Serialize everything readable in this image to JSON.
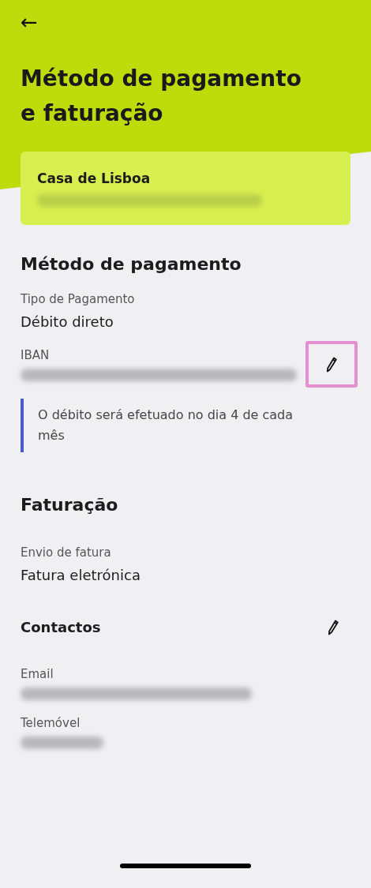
{
  "header": {
    "back": "←",
    "title": "Método de pagamento e faturação"
  },
  "account_card": {
    "name": "Casa de Lisboa",
    "address_blurred": true
  },
  "payment": {
    "heading": "Método de pagamento",
    "fields": [
      {
        "label": "Tipo de Pagamento",
        "value": "Débito direto"
      },
      {
        "label": "IBAN",
        "blurred": true,
        "editable": true,
        "highlighted": true
      }
    ],
    "note": "O débito será efetuado no dia 4 de cada mês"
  },
  "billing": {
    "heading": "Faturação",
    "fields": [
      {
        "label": "Envio de fatura",
        "value": "Fatura eletrónica"
      }
    ],
    "contacts": {
      "heading": "Contactos",
      "editable": true,
      "fields": [
        {
          "label": "Email",
          "blurred": true
        },
        {
          "label": "Telemóvel",
          "blurred": true
        }
      ]
    }
  }
}
